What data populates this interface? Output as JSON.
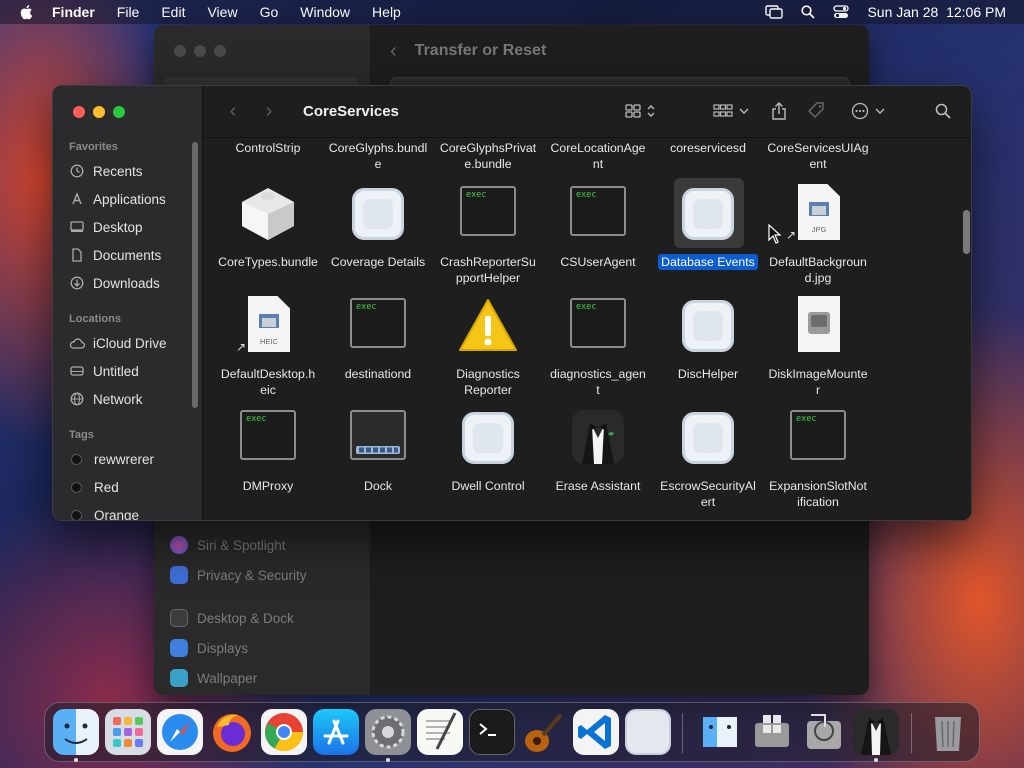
{
  "menubar": {
    "app_name": "Finder",
    "menus": [
      "File",
      "Edit",
      "View",
      "Go",
      "Window",
      "Help"
    ],
    "datetime": "Sun Jan 28  12:06 PM",
    "status_icons": [
      "screen-mirroring-icon",
      "search-icon",
      "control-center-icon"
    ]
  },
  "settings_window": {
    "header_title": "Transfer or Reset",
    "sidebar_items": [
      {
        "label": "Siri & Spotlight",
        "icon": "siri-icon",
        "color": "#6a4fbf"
      },
      {
        "label": "Privacy & Security",
        "icon": "hand-icon",
        "color": "#3f6fd8"
      },
      {
        "label": "Desktop & Dock",
        "icon": "dock-icon",
        "color": "#444444"
      },
      {
        "label": "Displays",
        "icon": "display-icon",
        "color": "#3f7fe0"
      },
      {
        "label": "Wallpaper",
        "icon": "wallpaper-icon",
        "color": "#3aa0c8"
      }
    ]
  },
  "finder": {
    "title": "CoreServices",
    "sidebar": {
      "favorites_title": "Favorites",
      "favorites": [
        {
          "label": "Recents",
          "icon": "clock-icon"
        },
        {
          "label": "Applications",
          "icon": "applications-icon"
        },
        {
          "label": "Desktop",
          "icon": "desktop-icon"
        },
        {
          "label": "Documents",
          "icon": "document-icon"
        },
        {
          "label": "Downloads",
          "icon": "download-icon"
        }
      ],
      "locations_title": "Locations",
      "locations": [
        {
          "label": "iCloud Drive",
          "icon": "cloud-icon"
        },
        {
          "label": "Untitled",
          "icon": "drive-icon"
        },
        {
          "label": "Network",
          "icon": "globe-icon"
        }
      ],
      "tags_title": "Tags",
      "tags": [
        {
          "label": "rewwrerer"
        },
        {
          "label": "Red"
        },
        {
          "label": "Orange"
        }
      ]
    },
    "partial_row": [
      "ControlStrip",
      "CoreGlyphs.bundl\ne",
      "CoreGlyphsPrivat\ne.bundle",
      "CoreLocationAge\nnt",
      "coreservicesd",
      "CoreServicesUIAg\nent"
    ],
    "items": [
      {
        "name": "CoreTypes.bundle",
        "kind": "bundle"
      },
      {
        "name": "Coverage Details",
        "kind": "app-blank"
      },
      {
        "name": "CrashReporterSu\npportHelper",
        "kind": "exec"
      },
      {
        "name": "CSUserAgent",
        "kind": "exec"
      },
      {
        "name": "Database Events",
        "kind": "app-blank",
        "selected": true
      },
      {
        "name": "DefaultBackgroun\nd.jpg",
        "kind": "doc-alias",
        "filetype": "JPG"
      },
      {
        "name": "DefaultDesktop.h\neic",
        "kind": "doc-alias",
        "filetype": "HEIC"
      },
      {
        "name": "destinationd",
        "kind": "exec"
      },
      {
        "name": "Diagnostics\nReporter",
        "kind": "warning"
      },
      {
        "name": "diagnostics_agen\nt",
        "kind": "exec"
      },
      {
        "name": "DiscHelper",
        "kind": "app-blank"
      },
      {
        "name": "DiskImageMounte\nr",
        "kind": "disk-image"
      },
      {
        "name": "DMProxy",
        "kind": "exec"
      },
      {
        "name": "Dock",
        "kind": "dock"
      },
      {
        "name": "Dwell Control",
        "kind": "app-blank"
      },
      {
        "name": "Erase Assistant",
        "kind": "tuxedo"
      },
      {
        "name": "EscrowSecurityAl\nert",
        "kind": "app-blank"
      },
      {
        "name": "ExpansionSlotNot\nification",
        "kind": "exec"
      }
    ],
    "exec_label": "exec"
  },
  "dock": {
    "apps": [
      {
        "name": "Finder",
        "icon": "finder-icon",
        "running": true
      },
      {
        "name": "Launchpad",
        "icon": "launchpad-icon",
        "running": false
      },
      {
        "name": "Safari",
        "icon": "safari-icon",
        "running": false
      },
      {
        "name": "Firefox",
        "icon": "firefox-icon",
        "running": false
      },
      {
        "name": "Chrome",
        "icon": "chrome-icon",
        "running": false
      },
      {
        "name": "App Store",
        "icon": "app-store-icon",
        "running": false
      },
      {
        "name": "System Settings",
        "icon": "settings-icon",
        "running": true
      },
      {
        "name": "TextEdit",
        "icon": "textedit-icon",
        "running": false
      },
      {
        "name": "Terminal",
        "icon": "terminal-icon",
        "running": false
      },
      {
        "name": "GarageBand",
        "icon": "guitar-icon",
        "running": false
      },
      {
        "name": "Visual Studio Code",
        "icon": "vscode-icon",
        "running": false
      },
      {
        "name": "Blank App",
        "icon": "blank-app-icon",
        "running": false
      },
      {
        "name": "Migration Assistant",
        "icon": "migration-icon",
        "running": false
      },
      {
        "name": "Boot Camp Assistant",
        "icon": "bootcamp-icon",
        "running": false
      },
      {
        "name": "Disk Utility",
        "icon": "disk-utility-icon",
        "running": false
      },
      {
        "name": "Erase Assistant",
        "icon": "tuxedo-icon",
        "running": true
      },
      {
        "name": "Trash",
        "icon": "trash-icon",
        "running": false
      }
    ]
  }
}
